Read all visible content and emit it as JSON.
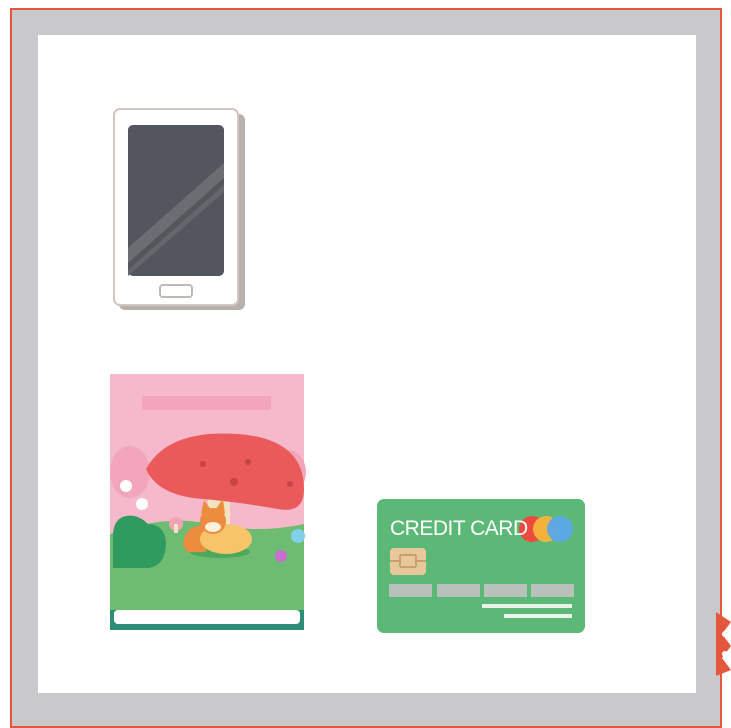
{
  "scene": {
    "items": [
      {
        "id": "phone",
        "kind": "smartphone"
      },
      {
        "id": "book",
        "kind": "storybook",
        "cover": "mushroom-and-fox"
      },
      {
        "id": "card",
        "kind": "credit-card",
        "label": "CREDIT CARD"
      }
    ]
  },
  "colors": {
    "frame_border": "#e4573d",
    "frame_fill": "#c9c9cb",
    "card_green": "#5cb877",
    "book_pink": "#f6b9cb",
    "mushroom_red": "#ea5a5a"
  }
}
